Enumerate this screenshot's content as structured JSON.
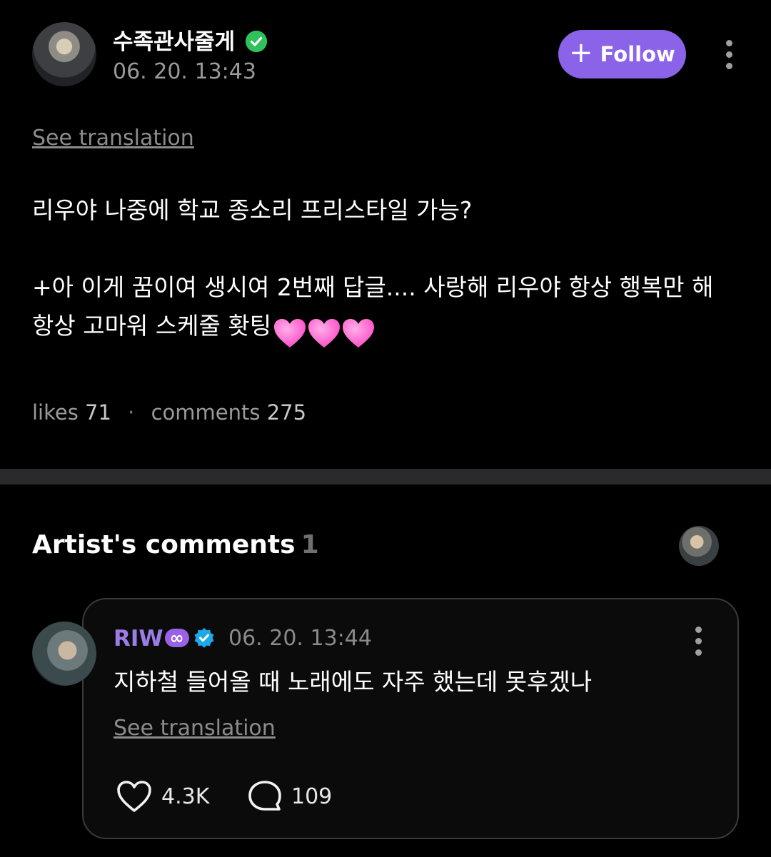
{
  "post": {
    "author_name": "수족관사줄게",
    "date": "06. 20. 13:43",
    "follow_label": "Follow",
    "see_translation": "See translation",
    "body_line1": "리우야 나중에 학교 종소리 프리스타일 가능?",
    "body_line2": "+아 이게 꿈이여 생시여 2번째 답글.... 사랑해 리우야 항상 행복만 해 항상 고마워 스케줄 홧팅",
    "likes_label": "likes",
    "likes_count": "71",
    "comments_label": "comments",
    "comments_count": "275"
  },
  "artist_comments": {
    "title": "Artist's comments",
    "count": "1",
    "comment": {
      "author": "RIW",
      "badge": "∞",
      "date": "06. 20. 13:44",
      "text": "지하철 들어올 때 노래에도 자주 했는데 못후겠나",
      "see_translation": "See translation",
      "likes": "4.3K",
      "replies": "109"
    }
  },
  "colors": {
    "accent_purple": "#8b63e8",
    "verified_green": "#2fc15c",
    "verified_blue": "#1ea8e6",
    "heart_pink": "#ff6fd0"
  },
  "icons": [
    "verified-check-icon",
    "plus-icon",
    "more-vertical-icon",
    "pink-heart-emoji",
    "infinity-icon",
    "verified-badge-icon",
    "heart-outline-icon",
    "comment-bubble-icon"
  ]
}
